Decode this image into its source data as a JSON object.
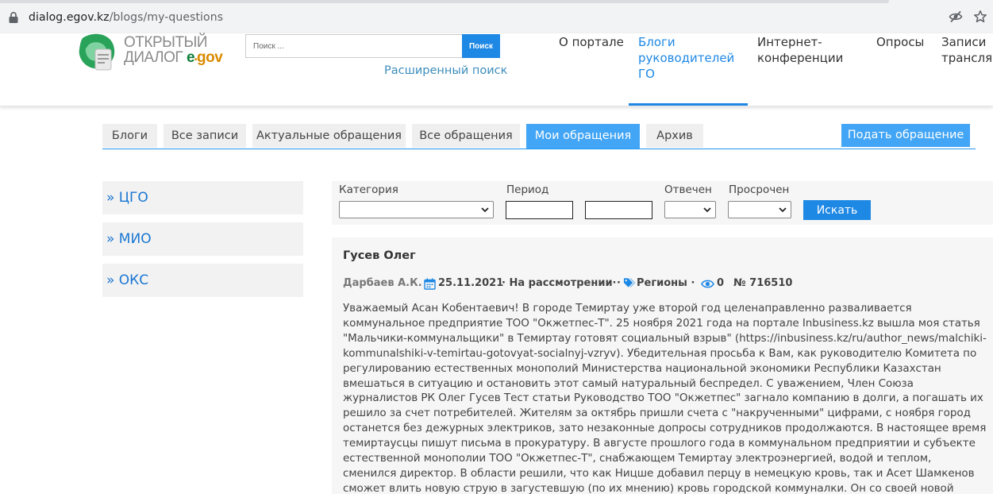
{
  "browser": {
    "url_domain": "dialog.egov.kz",
    "url_path": "/blogs/my-questions"
  },
  "header": {
    "logo_line1": "ОТКРЫТЫЙ",
    "logo_line2": "ДИАЛОГ",
    "logo_egov_e": "e",
    "logo_egov_gov": "gov",
    "search_placeholder": "Поиск ...",
    "search_button": "Поиск",
    "advanced_search": "Расширенный поиск",
    "nav": [
      {
        "label": "О портале"
      },
      {
        "label": "Блоги руководителей ГО",
        "lines": [
          "Блоги",
          "руководителей",
          "ГО"
        ]
      },
      {
        "label": "Интернет-конференции",
        "lines": [
          "Интернет-",
          "конференции"
        ]
      },
      {
        "label": "Опросы"
      },
      {
        "label": "Записи трансляций",
        "lines": [
          "Записи",
          "трансляц"
        ]
      }
    ]
  },
  "tabs": [
    {
      "label": "Блоги"
    },
    {
      "label": "Все записи"
    },
    {
      "label": "Актуальные обращения"
    },
    {
      "label": "Все обращения"
    },
    {
      "label": "Мои обращения",
      "active": true
    },
    {
      "label": "Архив"
    }
  ],
  "submit_button": "Подать обращение",
  "sidebar": {
    "items": [
      {
        "label": "» ЦГО"
      },
      {
        "label": "» МИО"
      },
      {
        "label": "» ОКС"
      }
    ]
  },
  "filters": {
    "category_label": "Категория",
    "period_label": "Период",
    "answered_label": "Отвечен",
    "overdue_label": "Просрочен",
    "search_button": "Искать"
  },
  "question": {
    "title": "Гусев Олег",
    "author": "Дарбаев А.К.",
    "date": "25.11.2021",
    "status": "· На рассмотрении·",
    "category": "· ",
    "category_label": "Регионы ·",
    "views": "0",
    "number": "№ 716510",
    "body": "Уважаемый Асан Кобентаевич! В городе Темиртау уже второй год целенаправленно разваливается коммунальное предприятие ТОО \"Окжетпес-Т\". 25 ноября 2021 года на портале Inbusiness.kz вышла моя статья \"Мальчики-коммунальщики\" в Темиртау готовят социальный взрыв\" (https://inbusiness.kz/ru/author_news/malchiki-kommunalshiki-v-temirtau-gotovyat-socialnyj-vzryv). Убедительная просьба к Вам, как руководителю Комитета по регулированию естественных монополий Министерства национальной экономики Республики Казахстан вмешаться в ситуацию и остановить этот самый натуральный беспредел. С уважением, Член Союза журналистов РК Олег Гусев Тест статьи Руководство ТОО \"Окжетпес\" загнало компанию в долги, а погашать их решило за счет потребителей. Жителям за октябрь пришли счета с \"накрученными\" цифрами, с ноября город останется без дежурных электриков, зато незаконные допросы сотрудников продолжаются. В настоящее время темиртаусцы пишут письма в прокуратуру. В августе прошлого года в коммунальном предприятии и субъекте естественной монополии ТОО \"Окжетпес-Т\", снабжающем Темиртау электроэнергией, водой и теплом, сменился директор. В области решили, что как Ницше добавил перцу в немецкую кровь, так и Асет Шамкенов сможет влить новую струю в загустевшую (по их мнению) кровь городской коммуналки. Он со своей новой командой собрался бороться с коррупцией и экономить"
  },
  "colors": {
    "accent": "#1e88e5",
    "tab_active": "#42a5f5",
    "link": "#3c8dbc",
    "sidebar_link": "#1976d2",
    "panel_bg": "#f6f6f6"
  }
}
